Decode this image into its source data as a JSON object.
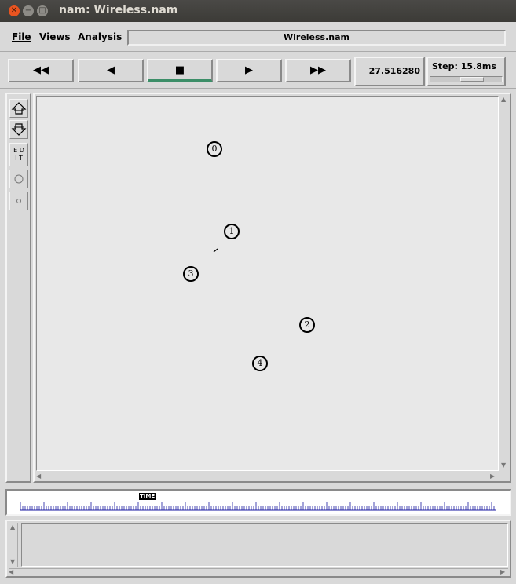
{
  "window": {
    "title": "nam: Wireless.nam"
  },
  "menu": {
    "file": "File",
    "views": "Views",
    "analysis": "Analysis"
  },
  "file_name": "Wireless.nam",
  "controls": {
    "rewind": "◀◀",
    "back": "◀",
    "stop": "■",
    "play": "▶",
    "fast_forward": "▶▶",
    "time": "27.516280",
    "step_label": "Step: 15.8ms",
    "step_slider_fraction": 0.6
  },
  "toolbox": {
    "edit": "E D\nI T"
  },
  "nodes": [
    {
      "label": "0"
    },
    {
      "label": "1"
    },
    {
      "label": "2"
    },
    {
      "label": "3"
    },
    {
      "label": "4"
    }
  ],
  "timeline": {
    "marker": "TIME"
  }
}
